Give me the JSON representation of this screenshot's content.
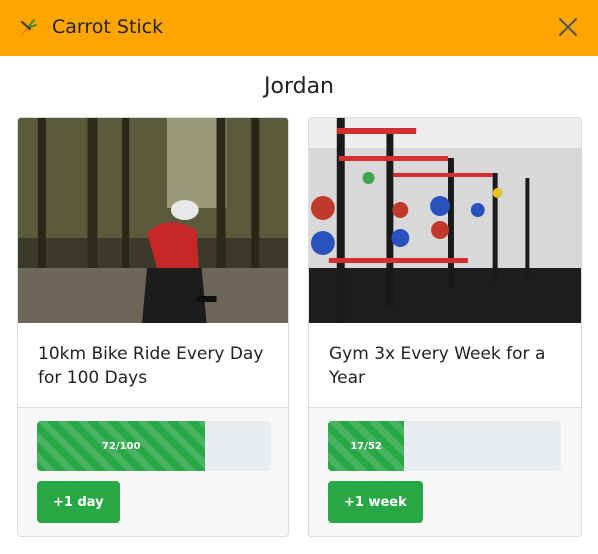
{
  "window": {
    "title": "Carrot Stick",
    "accent": "#ffa500",
    "icon": "carrot-icon",
    "close_icon": "close-icon"
  },
  "user": {
    "name": "Jordan"
  },
  "goals": [
    {
      "title": "10km Bike Ride Every Day for 100 Days",
      "image": "cyclist-photo",
      "progress_text": "72/100",
      "progress_value": 0.72,
      "button_label": "+1 day"
    },
    {
      "title": "Gym 3x Every Week for a Year",
      "image": "gym-rack-photo",
      "progress_text": "17/52",
      "progress_value": 0.327,
      "button_label": "+1 week"
    }
  ],
  "colors": {
    "success": "#28a745",
    "progress_track": "#e9ecef",
    "footer_bg": "#f7f7f7"
  }
}
